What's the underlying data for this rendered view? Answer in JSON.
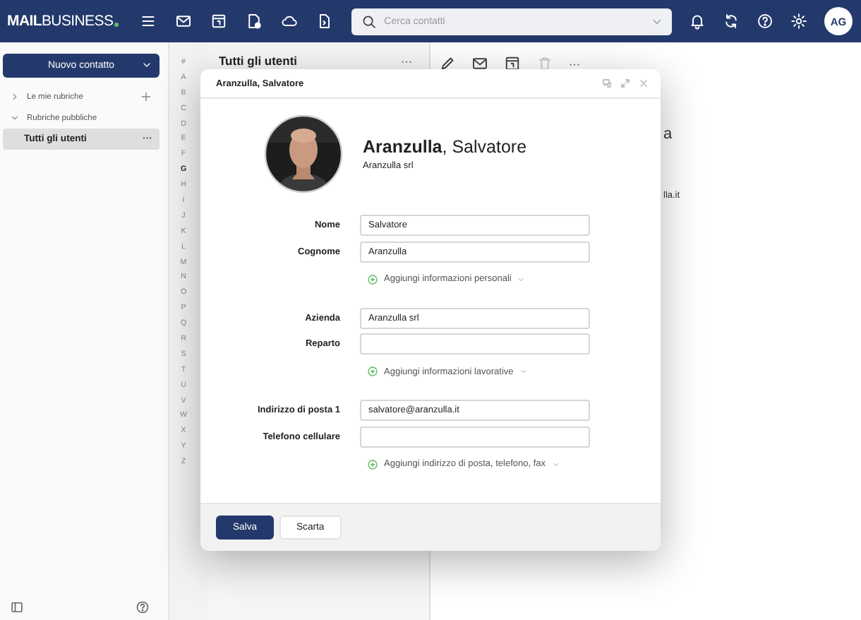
{
  "topbar": {
    "logo": "**MAIL**BUSINESS",
    "search": {
      "placeholder": "Cerca contatti"
    },
    "user_initials": "AG"
  },
  "sidebar": {
    "new_button": "Nuovo contatto",
    "groups": [
      {
        "label": "Le mie rubriche",
        "expanded": false
      },
      {
        "label": "Rubriche pubbliche",
        "expanded": true,
        "children": [
          {
            "label": "Tutti gli utenti",
            "selected": true,
            "menu": "···"
          }
        ]
      }
    ]
  },
  "alphabet": [
    {
      "label": "#",
      "selected": false
    },
    {
      "label": "A",
      "selected": false
    },
    {
      "label": "B",
      "selected": false
    },
    {
      "label": "C",
      "selected": false
    },
    {
      "label": "D",
      "selected": false
    },
    {
      "label": "E",
      "selected": false
    },
    {
      "label": "F",
      "selected": false
    },
    {
      "label": "G",
      "selected": true
    },
    {
      "label": "H",
      "selected": false
    },
    {
      "label": "I",
      "selected": false
    },
    {
      "label": "J",
      "selected": false
    },
    {
      "label": "K",
      "selected": false
    },
    {
      "label": "L",
      "selected": false
    },
    {
      "label": "M",
      "selected": false
    },
    {
      "label": "N",
      "selected": false
    },
    {
      "label": "O",
      "selected": false
    },
    {
      "label": "P",
      "selected": false
    },
    {
      "label": "Q",
      "selected": false
    },
    {
      "label": "R",
      "selected": false
    },
    {
      "label": "S",
      "selected": false
    },
    {
      "label": "T",
      "selected": false
    },
    {
      "label": "U",
      "selected": false
    },
    {
      "label": "V",
      "selected": false
    },
    {
      "label": "W",
      "selected": false
    },
    {
      "label": "X",
      "selected": false
    },
    {
      "label": "Y",
      "selected": false
    },
    {
      "label": "Z",
      "selected": false
    }
  ],
  "contact_list": {
    "title": "Tutti gli utenti",
    "menu": "···"
  },
  "detail": {
    "toolbar": [
      {
        "disabled": false
      },
      {
        "disabled": false
      },
      {
        "disabled": false
      },
      {
        "disabled": true
      }
    ],
    "menu": "···",
    "fragments": [
      "a",
      "lla.it"
    ]
  },
  "contact_dialog": {
    "title": "Aranzulla, Salvatore",
    "name": "**Aranzulla**, Salvatore",
    "company": "Aranzulla srl",
    "sections": [
      {
        "fields": [
          {
            "label": "Nome",
            "value": "Salvatore"
          },
          {
            "label": "Cognome",
            "value": "Aranzulla"
          }
        ],
        "add_link": "Aggiungi informazioni personali"
      },
      {
        "fields": [
          {
            "label": "Azienda",
            "value": "Aranzulla srl"
          },
          {
            "label": "Reparto"
          }
        ],
        "add_link": "Aggiungi informazioni lavorative"
      },
      {
        "fields": [
          {
            "label": "Indirizzo di posta 1",
            "value": "salvatore@aranzulla.it"
          },
          {
            "label": "Telefono cellulare"
          }
        ],
        "add_link": "Aggiungi indirizzo di posta, telefono, fax"
      }
    ],
    "buttons": [
      {
        "label": "Salva",
        "kind": "primary"
      },
      {
        "label": "Scarta",
        "kind": "secondary"
      }
    ]
  }
}
